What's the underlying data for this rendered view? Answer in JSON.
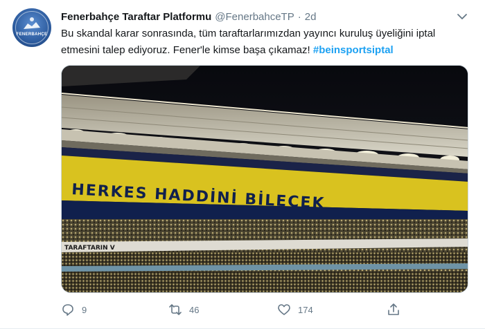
{
  "tweet": {
    "author_name": "Fenerbahçe Taraftar Platformu",
    "handle": "@FenerbahceTP",
    "separator": "·",
    "timestamp": "2d",
    "text_main": "Bu skandal karar sonrasında, tüm taraftarlarımızdan yayıncı kuruluş üyeliğini iptal etmesini talep ediyoruz. Fener'le kimse başa çıkamaz! ",
    "hashtag": "#beinsportsiptal",
    "avatar_text": "FENERBAHÇE",
    "banner_text": "HERKES HADDİNİ BİLECEK",
    "stand_text": "TARAFTARIN V",
    "replies": "9",
    "retweets": "46",
    "likes": "174"
  },
  "colors": {
    "accent": "#1da1f2",
    "muted": "#657786",
    "banner_yellow": "#d9c21f",
    "banner_navy": "#10204d"
  },
  "icons": {
    "reply": "reply-icon",
    "retweet": "retweet-icon",
    "like": "heart-icon",
    "share": "share-icon",
    "caret": "chevron-down-icon"
  }
}
